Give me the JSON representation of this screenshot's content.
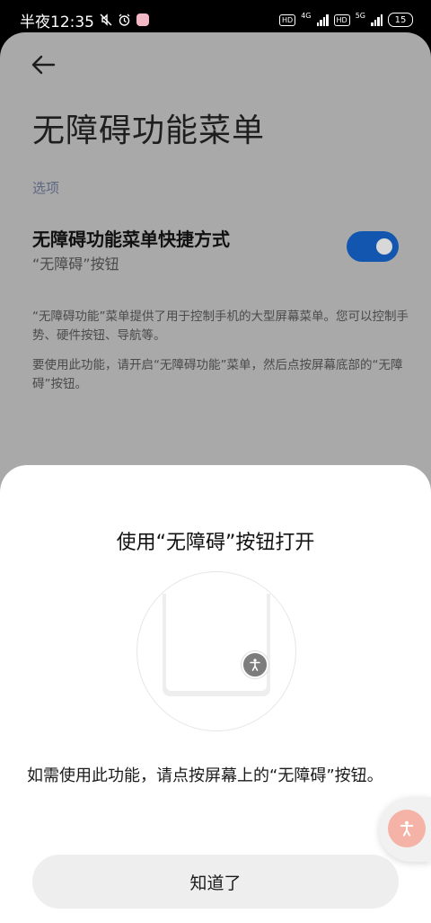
{
  "status_bar": {
    "time": "半夜12:35",
    "network1": "4G",
    "network2": "5G",
    "hd": "HD",
    "battery": "15"
  },
  "page": {
    "title": "无障碍功能菜单",
    "section_label": "选项",
    "shortcut": {
      "title": "无障碍功能菜单快捷方式",
      "subtitle": "“无障碍”按钮",
      "enabled": true
    },
    "description1": "“无障碍功能”菜单提供了用于控制手机的大型屏幕菜单。您可以控制手势、硬件按钮、导航等。",
    "description2": "要使用此功能，请开启“无障碍功能”菜单，然后点按屏幕底部的“无障碍”按钮。"
  },
  "sheet": {
    "title": "使用“无障碍”按钮打开",
    "body": "如需使用此功能，请点按屏幕上的“无障碍”按钮。",
    "ok_label": "知道了"
  },
  "colors": {
    "toggle_on": "#1356b0",
    "float_button": "#f4b3a6",
    "page_dim": "#a9a9a9"
  }
}
